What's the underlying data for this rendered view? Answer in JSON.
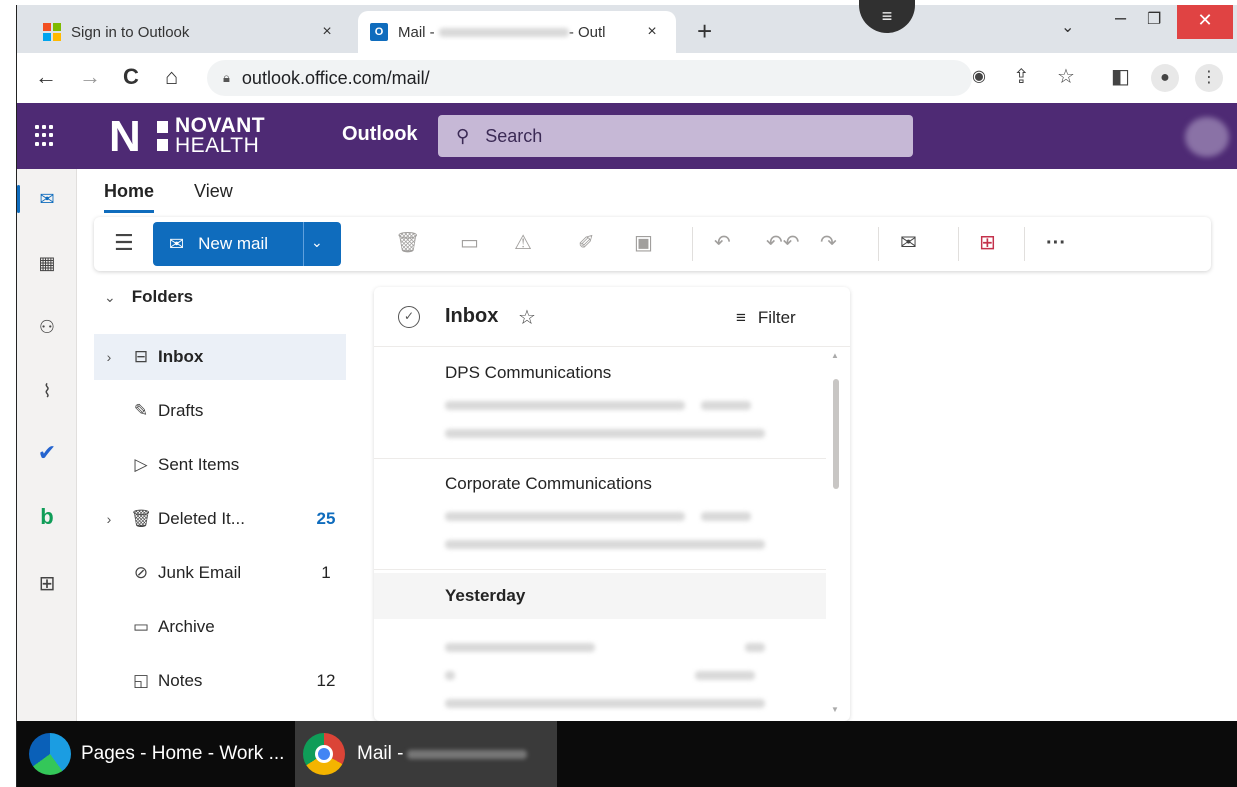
{
  "browser": {
    "tabs": [
      {
        "title": "Sign in to Outlook",
        "close": "×"
      },
      {
        "title_prefix": "Mail - ",
        "title_suffix": "- Outl",
        "close": "×"
      }
    ],
    "new_tab": "+",
    "url": "outlook.office.com/mail/"
  },
  "header": {
    "brand_mark": "N",
    "brand_line1": "NOVANT",
    "brand_line2": "HEALTH",
    "app_name": "Outlook",
    "search_placeholder": "Search"
  },
  "ribbon": {
    "tabs": [
      {
        "label": "Home"
      },
      {
        "label": "View"
      }
    ],
    "new_mail_label": "New mail",
    "more": "···"
  },
  "folders": {
    "header": "Folders",
    "items": [
      {
        "name": "Inbox",
        "count": ""
      },
      {
        "name": "Drafts",
        "count": ""
      },
      {
        "name": "Sent Items",
        "count": ""
      },
      {
        "name": "Deleted It...",
        "count": "25"
      },
      {
        "name": "Junk Email",
        "count": "1"
      },
      {
        "name": "Archive",
        "count": ""
      },
      {
        "name": "Notes",
        "count": "12"
      }
    ]
  },
  "message_list": {
    "title": "Inbox",
    "filter_label": "Filter",
    "messages": [
      {
        "sender": "DPS Communications"
      },
      {
        "sender": "Corporate Communications"
      }
    ],
    "group_yesterday": "Yesterday"
  },
  "taskbar": {
    "items": [
      {
        "label": "Pages - Home - Work ..."
      },
      {
        "label": "Mail - "
      }
    ]
  },
  "colors": {
    "brand_header": "#4e2a74",
    "accent": "#0f6cbd",
    "close_button": "#e04343"
  }
}
